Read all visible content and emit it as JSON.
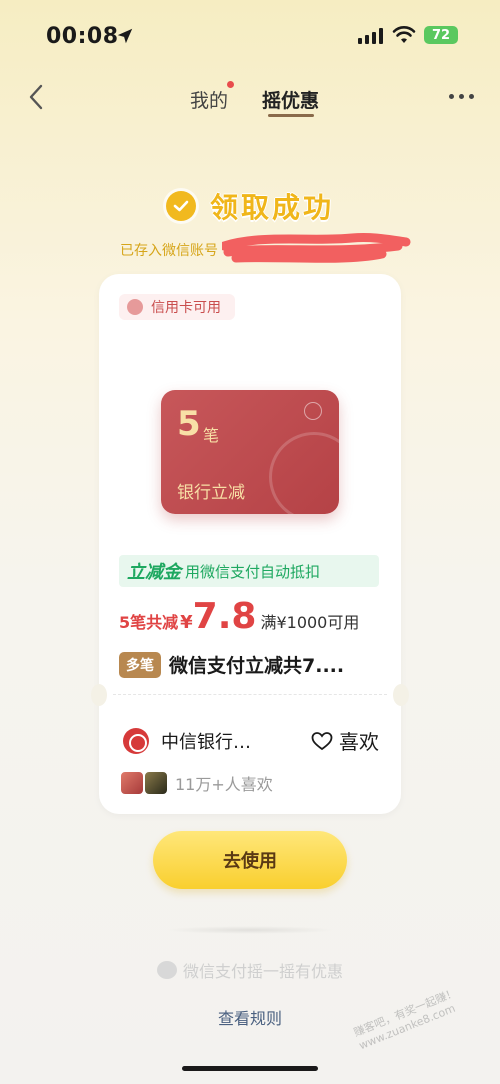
{
  "status_bar": {
    "time": "00:08",
    "battery": "72"
  },
  "nav": {
    "tab_mine": "我的",
    "tab_shake": "摇优惠"
  },
  "success": {
    "title": "领取成功",
    "saved": "已存入微信账号"
  },
  "card": {
    "tag": "信用卡可用",
    "bank_card": {
      "count": "5",
      "unit": "笔",
      "name": "银行立减"
    },
    "promo": {
      "label": "立减金",
      "desc": "用微信支付自动抵扣"
    },
    "price": {
      "prefix": "5笔共减",
      "currency": "¥",
      "value": "7.8",
      "condition": "满¥1000可用"
    },
    "badge": "多笔",
    "deal_title": "微信支付立减共7....",
    "merchant": "中信银行…",
    "like_label": "喜欢",
    "likes_count": "11万+人喜欢"
  },
  "use_button": "去使用",
  "footer": {
    "brand": "微信支付摇一摇有优惠",
    "rules": "查看规则"
  },
  "watermark": "赚客吧，有奖一起赚！\nwww.zuanke8.com",
  "colors": {
    "accent_gold": "#f0b61a",
    "price_red": "#e04444",
    "promo_green": "#1ea860",
    "button_yellow": "#f9cf2e"
  }
}
